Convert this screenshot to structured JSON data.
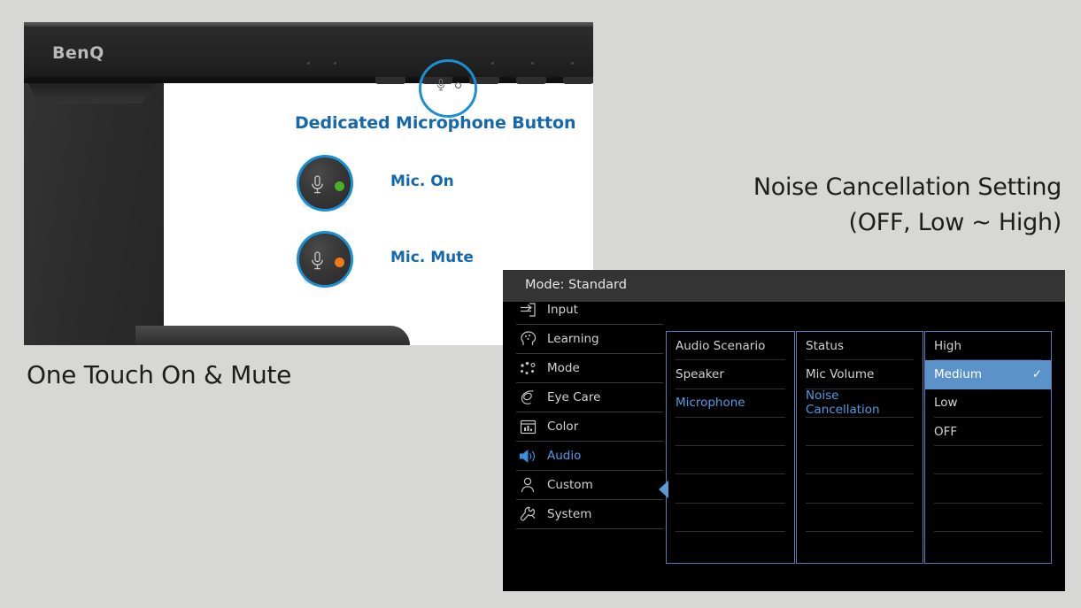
{
  "background_color": "#d7d7d5",
  "accent_blue": "#1b8fd4",
  "text_blue": "#1568ad",
  "osd_blue": "#4d9de8",
  "highlight_blue": "#5b92c8",
  "photo": {
    "brand_logo": "BenQ",
    "title": "Dedicated Microphone Button",
    "mic_button_icon": "microphone-icon",
    "states": [
      {
        "label": "Mic. On",
        "led_color": "#4caf2a",
        "icon": "microphone-icon"
      },
      {
        "label": "Mic. Mute",
        "led_color": "#ef7b17",
        "icon": "microphone-icon"
      }
    ]
  },
  "captions": {
    "left": "One Touch On & Mute",
    "right_line1": "Noise Cancellation Setting",
    "right_line2": "(OFF, Low ~ High)"
  },
  "osd": {
    "title": "Mode: Standard",
    "sidebar": [
      {
        "label": "Input",
        "icon": "input-arrow-icon",
        "selected": false
      },
      {
        "label": "Learning",
        "icon": "head-learning-icon",
        "selected": false
      },
      {
        "label": "Mode",
        "icon": "dots-mode-icon",
        "selected": false
      },
      {
        "label": "Eye Care",
        "icon": "eye-care-icon",
        "selected": false
      },
      {
        "label": "Color",
        "icon": "color-chart-icon",
        "selected": false
      },
      {
        "label": "Audio",
        "icon": "speaker-icon",
        "selected": true
      },
      {
        "label": "Custom",
        "icon": "user-icon",
        "selected": false
      },
      {
        "label": "System",
        "icon": "wrench-icon",
        "selected": false
      }
    ],
    "column1": [
      {
        "label": "Audio Scenario",
        "selected": false
      },
      {
        "label": "Speaker",
        "selected": false
      },
      {
        "label": "Microphone",
        "selected": true
      },
      {
        "label": "",
        "selected": false
      },
      {
        "label": "",
        "selected": false
      },
      {
        "label": "",
        "selected": false
      },
      {
        "label": "",
        "selected": false
      },
      {
        "label": "",
        "selected": false
      }
    ],
    "column2": [
      {
        "label": "Status",
        "selected": false
      },
      {
        "label": "Mic Volume",
        "selected": false
      },
      {
        "label": "Noise Cancellation",
        "selected": true
      },
      {
        "label": "",
        "selected": false
      },
      {
        "label": "",
        "selected": false
      },
      {
        "label": "",
        "selected": false
      },
      {
        "label": "",
        "selected": false
      },
      {
        "label": "",
        "selected": false
      }
    ],
    "column3": [
      {
        "label": "High",
        "highlighted": false,
        "check": ""
      },
      {
        "label": "Medium",
        "highlighted": true,
        "check": "✓"
      },
      {
        "label": "Low",
        "highlighted": false,
        "check": ""
      },
      {
        "label": "OFF",
        "highlighted": false,
        "check": ""
      },
      {
        "label": "",
        "highlighted": false,
        "check": ""
      },
      {
        "label": "",
        "highlighted": false,
        "check": ""
      },
      {
        "label": "",
        "highlighted": false,
        "check": ""
      },
      {
        "label": "",
        "highlighted": false,
        "check": ""
      }
    ]
  }
}
